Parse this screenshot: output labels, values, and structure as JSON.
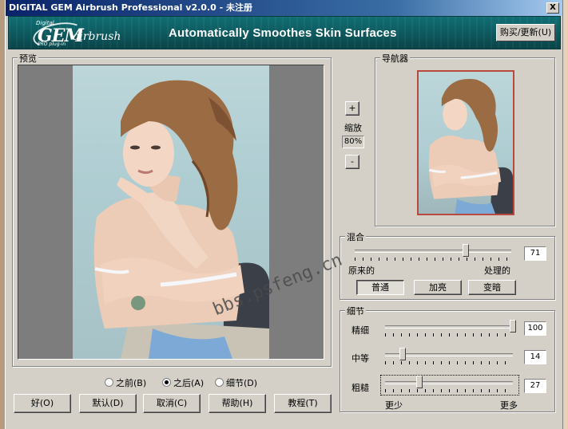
{
  "window": {
    "title": "DIGITAL GEM Airbrush Professional v2.0.0 - 未注册",
    "close_label": "X"
  },
  "banner": {
    "logo_digital": "Digital",
    "logo_gem": "GEM",
    "logo_airbrush": "airbrush",
    "logo_plugin": "PRO plug-in",
    "tagline": "Automatically Smoothes Skin Surfaces",
    "buy_label": "购买/更新(U)"
  },
  "preview": {
    "group_label": "预览"
  },
  "zoom": {
    "plus_label": "+",
    "label": "缩放",
    "value": "80%",
    "minus_label": "-"
  },
  "navigator": {
    "group_label": "导航器"
  },
  "blend": {
    "group_label": "混合",
    "value": "71",
    "fraction": 0.71,
    "left_label": "原来的",
    "right_label": "处理的",
    "modes": [
      "普通",
      "加亮",
      "变暗"
    ],
    "active_mode": "普通"
  },
  "detail": {
    "group_label": "细节",
    "rows": [
      {
        "label": "精细",
        "value": "100",
        "fraction": 1.0
      },
      {
        "label": "中等",
        "value": "14",
        "fraction": 0.14
      },
      {
        "label": "粗糙",
        "value": "27",
        "fraction": 0.27
      }
    ],
    "less_label": "更少",
    "more_label": "更多"
  },
  "view_radios": {
    "options": [
      "之前(B)",
      "之后(A)",
      "细节(D)"
    ],
    "selected": "之后(A)"
  },
  "buttons": {
    "ok": "好(O)",
    "default": "默认(D)",
    "cancel": "取消(C)",
    "help": "帮助(H)",
    "tutorial": "教程(T)"
  },
  "watermark": "bbs.psfeng.cn",
  "colors": {
    "titlebar": "#0a246a",
    "banner": "#0d5a5f",
    "dialog": "#d4d0c8",
    "nav_frame": "#b9483f"
  }
}
